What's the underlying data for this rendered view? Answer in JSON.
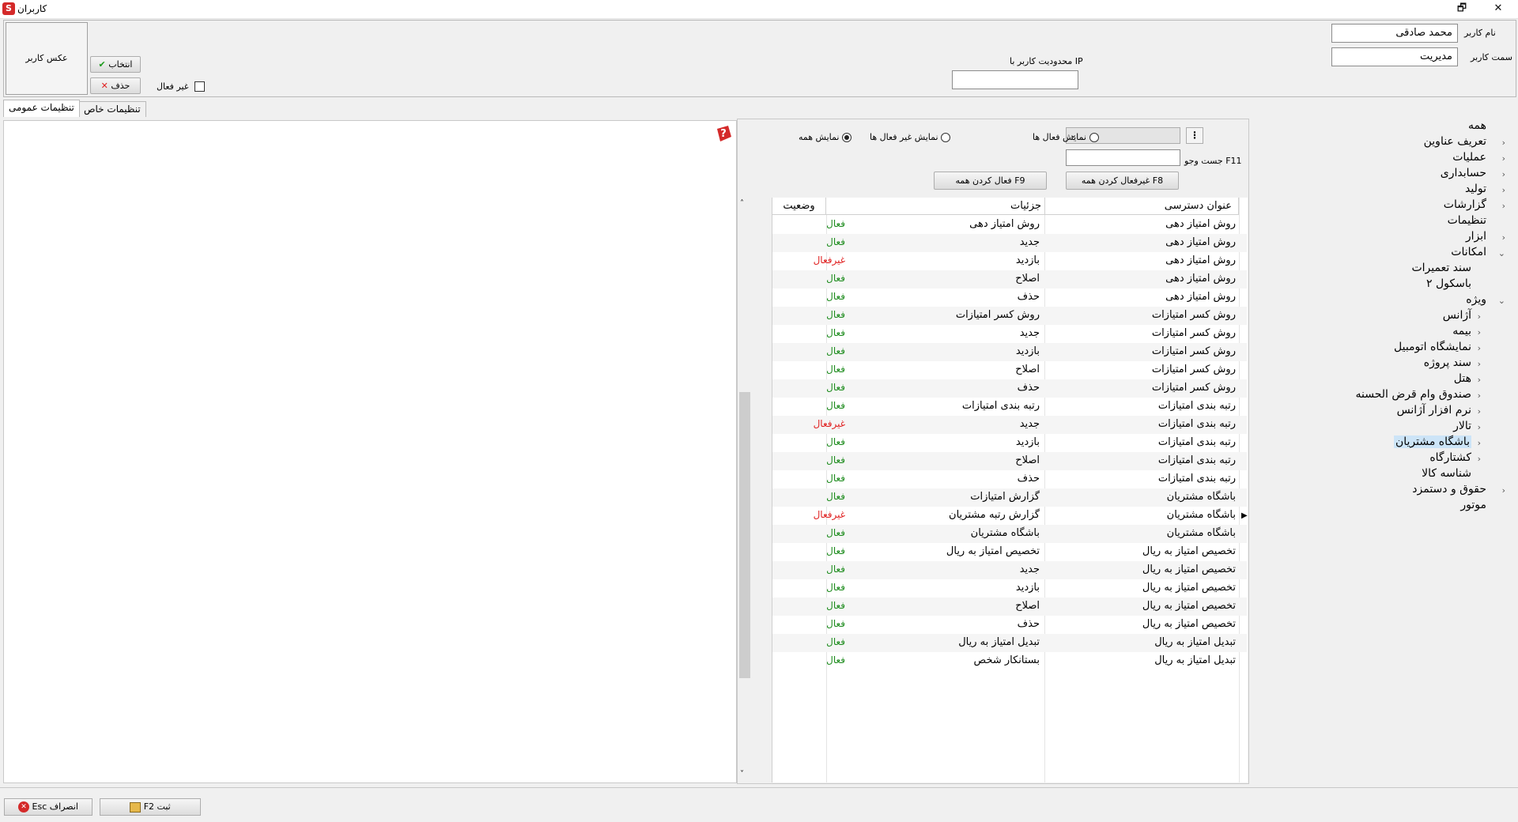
{
  "window": {
    "title": "کاربران",
    "controls": [
      "🗗",
      "✕"
    ]
  },
  "header": {
    "username_label": "نام کاربر",
    "username_value": "محمد صادقی",
    "role_label": "سمت کاربر",
    "role_value": "مدیریت",
    "ip_label": "محدودیت کاربر با IP",
    "ip_value": "",
    "photo_label": "عکس کاربر",
    "select_button": "انتخاب",
    "delete_button": "حذف",
    "inactive_label": "غیر فعال"
  },
  "tabs": {
    "general": "تنظیمات عمومی",
    "special": "تنظیمات خاص"
  },
  "tree": {
    "items": [
      {
        "label": "همه"
      },
      {
        "label": "تعریف عناوین"
      },
      {
        "label": "عملیات"
      },
      {
        "label": "حسابداری"
      },
      {
        "label": "تولید"
      },
      {
        "label": "گزارشات"
      },
      {
        "label": "تنظیمات"
      },
      {
        "label": "ابزار"
      },
      {
        "label": "امکانات"
      },
      {
        "label": "سند تعمیرات"
      },
      {
        "label": "باسکول ۲"
      },
      {
        "label": "ویژه"
      },
      {
        "label": "آژانس"
      },
      {
        "label": "بیمه"
      },
      {
        "label": "نمایشگاه اتومبیل"
      },
      {
        "label": "سند پروژه"
      },
      {
        "label": "هتل"
      },
      {
        "label": "صندوق وام قرض الحسنه"
      },
      {
        "label": "نرم افزار آژانس"
      },
      {
        "label": "تالار"
      },
      {
        "label": "باشگاه مشتریان"
      },
      {
        "label": "کشتارگاه"
      },
      {
        "label": "شناسه کالا"
      },
      {
        "label": "حقوق و دستمزد"
      },
      {
        "label": "موتور"
      }
    ]
  },
  "filters": {
    "show_all": "نمایش همه",
    "show_inactive": "نمایش غیر فعال ها",
    "show_active": "نمایش فعال ها",
    "search_label": "جست وجو F11",
    "search_value": "",
    "deactivate_all": "غیرفعال کردن همه F8",
    "activate_all": "فعال کردن همه F9"
  },
  "grid": {
    "columns": [
      "عنوان دسترسی",
      "جزئیات",
      "وضعیت"
    ],
    "status_colors": {
      "active": "#1e8c1e",
      "inactive": "#e02020"
    },
    "rows": [
      {
        "title": "روش امتیاز دهی",
        "detail": "روش امتیاز دهی",
        "status": "فعال"
      },
      {
        "title": "روش امتیاز دهی",
        "detail": "جدید",
        "status": "فعال"
      },
      {
        "title": "روش امتیاز دهی",
        "detail": "بازدید",
        "status": "غیرفعال"
      },
      {
        "title": "روش امتیاز دهی",
        "detail": "اصلاح",
        "status": "فعال"
      },
      {
        "title": "روش امتیاز دهی",
        "detail": "حذف",
        "status": "فعال"
      },
      {
        "title": "روش کسر امتیازات",
        "detail": "روش کسر امتیازات",
        "status": "فعال"
      },
      {
        "title": "روش کسر امتیازات",
        "detail": "جدید",
        "status": "فعال"
      },
      {
        "title": "روش کسر امتیازات",
        "detail": "بازدید",
        "status": "فعال"
      },
      {
        "title": "روش کسر امتیازات",
        "detail": "اصلاح",
        "status": "فعال"
      },
      {
        "title": "روش کسر امتیازات",
        "detail": "حذف",
        "status": "فعال"
      },
      {
        "title": "رتبه بندی امتیازات",
        "detail": "رتبه بندی امتیازات",
        "status": "فعال"
      },
      {
        "title": "رتبه بندی امتیازات",
        "detail": "جدید",
        "status": "غیرفعال"
      },
      {
        "title": "رتبه بندی امتیازات",
        "detail": "بازدید",
        "status": "فعال"
      },
      {
        "title": "رتبه بندی امتیازات",
        "detail": "اصلاح",
        "status": "فعال"
      },
      {
        "title": "رتبه بندی امتیازات",
        "detail": "حذف",
        "status": "فعال"
      },
      {
        "title": "باشگاه مشتریان",
        "detail": "گزارش امتیازات",
        "status": "فعال"
      },
      {
        "title": "باشگاه مشتریان",
        "detail": "گزارش رتبه مشتریان",
        "status": "غیرفعال"
      },
      {
        "title": "باشگاه مشتریان",
        "detail": "باشگاه مشتریان",
        "status": "فعال"
      },
      {
        "title": "تخصیص امتیاز به ریال",
        "detail": "تخصیص امتیاز به ریال",
        "status": "فعال"
      },
      {
        "title": "تخصیص امتیاز به ریال",
        "detail": "جدید",
        "status": "فعال"
      },
      {
        "title": "تخصیص امتیاز به ریال",
        "detail": "بازدید",
        "status": "فعال"
      },
      {
        "title": "تخصیص امتیاز به ریال",
        "detail": "اصلاح",
        "status": "فعال"
      },
      {
        "title": "تخصیص امتیاز به ریال",
        "detail": "حذف",
        "status": "فعال"
      },
      {
        "title": "تبدیل امتیاز به ریال",
        "detail": "تبدیل امتیاز به ریال",
        "status": "فعال"
      },
      {
        "title": "تبدیل امتیاز به ریال",
        "detail": "بستانکار شخص",
        "status": "فعال"
      }
    ]
  },
  "footer": {
    "cancel_button": "انصراف Esc",
    "save_button": "ثبت F2"
  }
}
